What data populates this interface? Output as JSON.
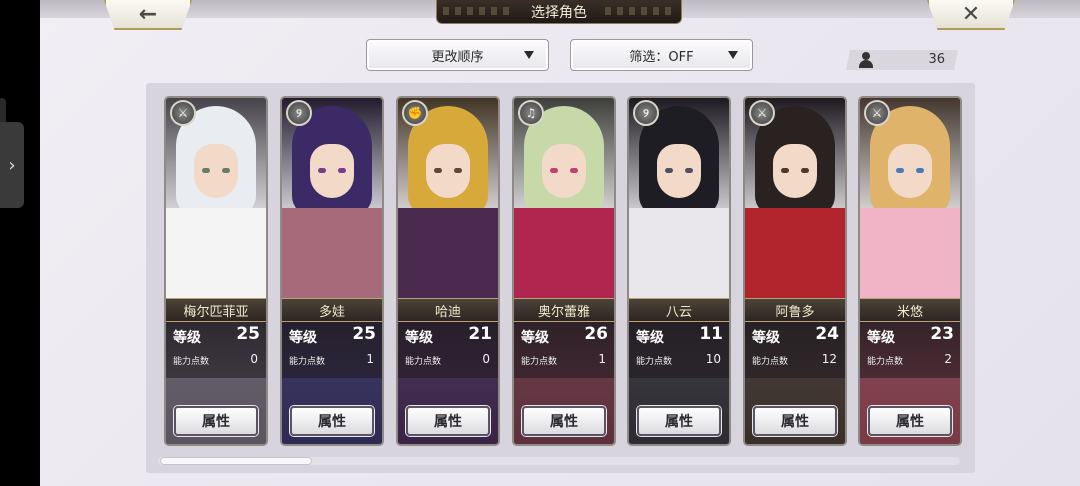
{
  "header": {
    "title": "选择角色",
    "back_icon": "←",
    "close_icon": "✕"
  },
  "toolbar": {
    "sort_label": "更改顺序",
    "filter_label": "筛选：OFF",
    "character_count": "36"
  },
  "side_tab": {
    "icon": "›"
  },
  "cards": [
    {
      "name": "梅尔匹菲亚",
      "level_label": "等级",
      "level": "25",
      "ap_label": "能力点数",
      "ap": "0",
      "type_icon": "sword-icon",
      "type_glyph": "⚔",
      "attr_label": "属性",
      "hair": "#e9ecf1",
      "outfit": "#f4f4f4",
      "lower": "#5b5560",
      "eye": "#6a7b6e"
    },
    {
      "name": "多娃",
      "level_label": "等级",
      "level": "25",
      "ap_label": "能力点数",
      "ap": "1",
      "type_icon": "staff-icon",
      "type_glyph": "୨",
      "attr_label": "属性",
      "hair": "#3b2a66",
      "outfit": "#a66a7a",
      "lower": "#2f2a55",
      "eye": "#7a3d8c"
    },
    {
      "name": "哈迪",
      "level_label": "等级",
      "level": "21",
      "ap_label": "能力点数",
      "ap": "0",
      "type_icon": "gauntlet-icon",
      "type_glyph": "✊",
      "attr_label": "属性",
      "hair": "#d7a93a",
      "outfit": "#4a2b4f",
      "lower": "#3a2448",
      "eye": "#5b4a2f"
    },
    {
      "name": "奥尔蕾雅",
      "level_label": "等级",
      "level": "26",
      "ap_label": "能力点数",
      "ap": "1",
      "type_icon": "bell-icon",
      "type_glyph": "♫",
      "attr_label": "属性",
      "hair": "#c7d9a9",
      "outfit": "#b0264f",
      "lower": "#5e2f3c",
      "eye": "#c04070"
    },
    {
      "name": "八云",
      "level_label": "等级",
      "level": "11",
      "ap_label": "能力点数",
      "ap": "10",
      "type_icon": "staff-icon",
      "type_glyph": "୨",
      "attr_label": "属性",
      "hair": "#1e1d24",
      "outfit": "#e8e6ea",
      "lower": "#2e2b33",
      "eye": "#505060"
    },
    {
      "name": "阿鲁多",
      "level_label": "等级",
      "level": "24",
      "ap_label": "能力点数",
      "ap": "12",
      "type_icon": "sword-icon",
      "type_glyph": "⚔",
      "attr_label": "属性",
      "hair": "#2a2220",
      "outfit": "#b2252c",
      "lower": "#3a2f2a",
      "eye": "#4b3a30"
    },
    {
      "name": "米悠",
      "level_label": "等级",
      "level": "23",
      "ap_label": "能力点数",
      "ap": "2",
      "type_icon": "sword-icon",
      "type_glyph": "⚔",
      "attr_label": "属性",
      "hair": "#e0b36a",
      "outfit": "#f1b3c6",
      "lower": "#7a3a45",
      "eye": "#4a7ab8"
    }
  ]
}
